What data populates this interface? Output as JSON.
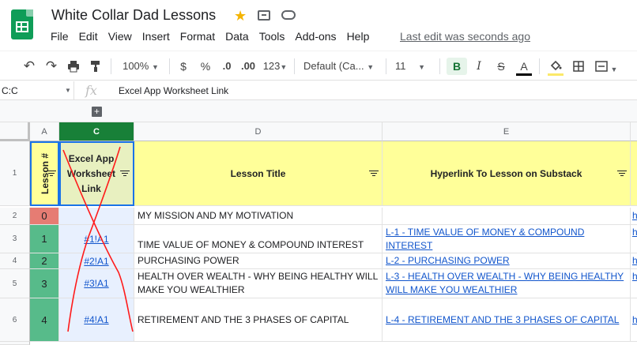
{
  "document": {
    "title": "White Collar Dad Lessons",
    "last_edit": "Last edit was seconds ago"
  },
  "menu": [
    "File",
    "Edit",
    "View",
    "Insert",
    "Format",
    "Data",
    "Tools",
    "Add-ons",
    "Help"
  ],
  "toolbar": {
    "zoom": "100%",
    "currency": "$",
    "percent": "%",
    "decrease_decimal": ".0",
    "increase_decimal": ".00",
    "more_formats": "123",
    "font": "Default (Ca...",
    "font_size": "11",
    "bold": "B",
    "italic": "I",
    "strikethrough": "S",
    "text_color": "A",
    "colors": {
      "fill": "#fbe969",
      "text": "#000000",
      "bold_active": "#137333"
    }
  },
  "formula_bar": {
    "name_box": "C:C",
    "fx": "fx",
    "content": "Excel App Worksheet Link"
  },
  "group_expand": "+",
  "columns": [
    "A",
    "C",
    "D",
    "E"
  ],
  "header_row": {
    "row": "1",
    "lesson_num": "Lesson #",
    "worksheet_link": "Excel App Worksheet Link",
    "lesson_title": "Lesson Title",
    "hyperlink": "Hyperlink To Lesson on Substack"
  },
  "rows": [
    {
      "row": "2",
      "num": "0",
      "link": "",
      "title": "MY MISSION AND MY MOTIVATION",
      "substack": ""
    },
    {
      "row": "3",
      "num": "1",
      "link": "#1!A1",
      "title": "TIME VALUE OF MONEY & COMPOUND INTEREST",
      "substack": "L-1 - TIME VALUE OF MONEY & COMPOUND INTEREST"
    },
    {
      "row": "4",
      "num": "2",
      "link": "#2!A1",
      "title": "PURCHASING POWER",
      "substack": "L-2 - PURCHASING POWER"
    },
    {
      "row": "5",
      "num": "3",
      "link": "#3!A1",
      "title": "HEALTH OVER WEALTH - WHY BEING HEALTHY WILL MAKE YOU WEALTHIER",
      "substack": "L-3 - HEALTH OVER WEALTH - WHY BEING HEALTHY WILL MAKE YOU WEALTHIER"
    },
    {
      "row": "6",
      "num": "4",
      "link": "#4!A1",
      "title": "RETIREMENT AND THE 3 PHASES OF CAPITAL",
      "substack": "L-4 - RETIREMENT AND THE 3 PHASES OF CAPITAL"
    }
  ],
  "overflow_col_text": "h"
}
